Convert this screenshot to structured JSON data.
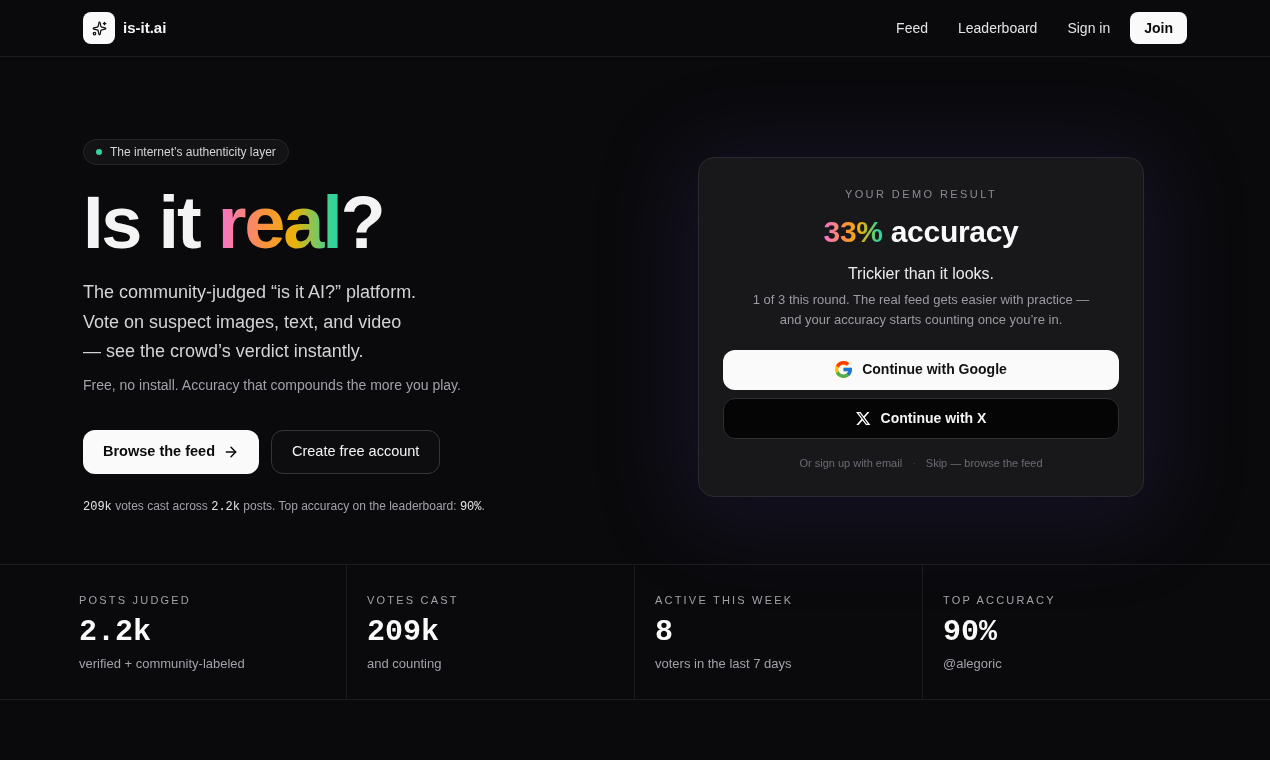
{
  "header": {
    "brand": "is-it.ai",
    "nav": [
      {
        "label": "Feed",
        "kind": "link"
      },
      {
        "label": "Leaderboard",
        "kind": "link"
      },
      {
        "label": "Sign in",
        "kind": "link"
      },
      {
        "label": "Join",
        "kind": "button"
      }
    ]
  },
  "hero": {
    "badge": "The internet’s authenticity layer",
    "heading": {
      "before": "Is it ",
      "highlight": "real",
      "after": "?"
    },
    "lead_lines": [
      "The community-judged “is it AI?” platform.",
      "Vote on suspect images, text, and video",
      "— see the crowd’s verdict instantly."
    ],
    "note": "Free, no install. Accuracy that compounds the more you play.",
    "actions": [
      {
        "label": "Browse the feed",
        "kind": "primary"
      },
      {
        "label": "Create free account",
        "kind": "secondary"
      }
    ],
    "stats_line": [
      {
        "text": "209k",
        "kind": "mono"
      },
      {
        "text": " votes cast across ",
        "kind": "plain"
      },
      {
        "text": "2.2k",
        "kind": "mono"
      },
      {
        "text": " posts. Top accuracy on the leaderboard: ",
        "kind": "plain"
      },
      {
        "text": "90%",
        "kind": "mono"
      },
      {
        "text": ".",
        "kind": "plain"
      }
    ]
  },
  "demo_card": {
    "eyebrow": "YOUR DEMO RESULT",
    "score": "33%",
    "score_label": "accuracy",
    "title": "Trickier than it looks.",
    "message_lines": [
      "1 of 3 this round. The real feed gets easier with practice —",
      "and your accuracy starts counting once you’re in."
    ],
    "providers": [
      {
        "label": "Continue with Google",
        "kind": "google"
      },
      {
        "label": "Continue with X",
        "kind": "x"
      }
    ],
    "links": [
      "Or sign up with email",
      "Skip — browse the feed"
    ],
    "separator": "·"
  },
  "stats": [
    {
      "label": "POSTS JUDGED",
      "value": "2.2k",
      "caption": "verified + community-labeled"
    },
    {
      "label": "VOTES CAST",
      "value": "209k",
      "caption": "and counting"
    },
    {
      "label": "ACTIVE THIS WEEK",
      "value": "8",
      "caption": "voters in the last 7 days"
    },
    {
      "label": "TOP ACCURACY",
      "value": "90%",
      "caption": "@alegoric"
    }
  ]
}
